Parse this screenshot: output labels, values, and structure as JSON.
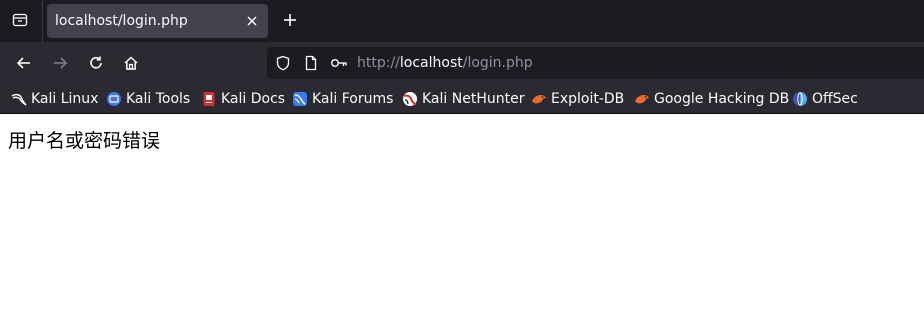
{
  "tab": {
    "title": "localhost/login.php"
  },
  "icons": {
    "tab_list": "tab-list-icon",
    "close": "close-icon",
    "new_tab": "plus-icon",
    "back": "arrow-left-icon",
    "forward": "arrow-right-icon",
    "reload": "reload-icon",
    "home": "home-icon",
    "shield": "shield-icon",
    "page": "page-icon",
    "key": "key-icon"
  },
  "url": {
    "scheme": "http://",
    "host": "localhost",
    "path": "/login.php"
  },
  "bookmarks": [
    {
      "label": "Kali Linux",
      "icon": "kali-dragon-icon"
    },
    {
      "label": "Kali Tools",
      "icon": "kali-tools-icon"
    },
    {
      "label": "Kali Docs",
      "icon": "kali-docs-icon"
    },
    {
      "label": "Kali Forums",
      "icon": "kali-forums-icon"
    },
    {
      "label": "Kali NetHunter",
      "icon": "kali-nethunter-icon"
    },
    {
      "label": "Exploit-DB",
      "icon": "exploit-db-icon"
    },
    {
      "label": "Google Hacking DB",
      "icon": "ghdb-icon"
    },
    {
      "label": "OffSec",
      "icon": "offsec-icon"
    }
  ],
  "page": {
    "message": "用户名或密码错误"
  },
  "colors": {
    "tabbar_bg": "#1c1b22",
    "toolbar_bg": "#2b2a33",
    "active_tab_bg": "#42414d",
    "urlbar_bg": "#1c1b22",
    "text_light": "#fbfbfe",
    "text_muted": "#8f8f9d",
    "page_bg": "#ffffff"
  }
}
